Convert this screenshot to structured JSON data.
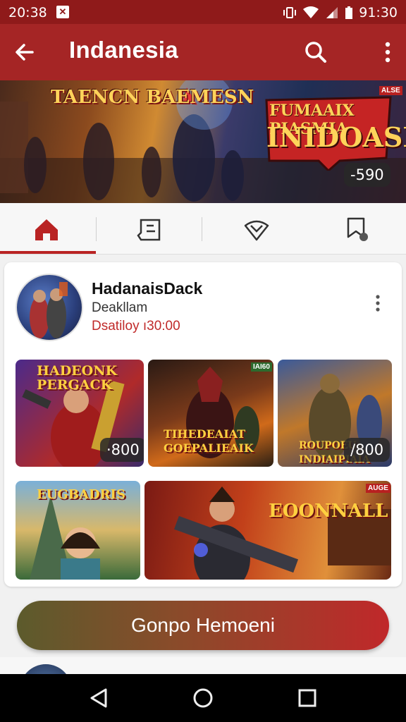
{
  "status_bar": {
    "time": "20:38",
    "right_time": "91:30"
  },
  "app_bar": {
    "title": "Indanesia"
  },
  "hero": {
    "title_left": "TAENCN BAEMESN",
    "title_right_small": "FUMAAIX PIASMIA",
    "title_right": "INIDOASIA",
    "badge": "ALSE",
    "price": "-590"
  },
  "tabs": [
    {
      "name": "home",
      "icon": "home-icon"
    },
    {
      "name": "list",
      "icon": "tag-list-icon"
    },
    {
      "name": "deals",
      "icon": "diamond-icon"
    },
    {
      "name": "profile",
      "icon": "profile-notification-icon"
    }
  ],
  "profile": {
    "name": "HadanaisDack",
    "subtitle": "Deakllam",
    "status": "Dsatiloy ı30:00"
  },
  "tiles": [
    {
      "title": "HADEONK PERGACK",
      "price": "·800",
      "badge": ""
    },
    {
      "title": "TIHEDEAIAT GOEPALIEAIK",
      "price": "",
      "badge": "IAI60"
    },
    {
      "title": "ROUPOEU INDIAIPIAIA",
      "price": "/800",
      "badge": ""
    },
    {
      "title": "EUGBADRIS",
      "price": "",
      "badge": ""
    },
    {
      "title": "EOONNALL",
      "price": "",
      "badge": "AUGE"
    }
  ],
  "cta": {
    "label": "Gonpo Hemoeni"
  },
  "colors": {
    "primary": "#a52525",
    "status_bar": "#8f1a1a",
    "accent_red": "#c02a2a"
  }
}
